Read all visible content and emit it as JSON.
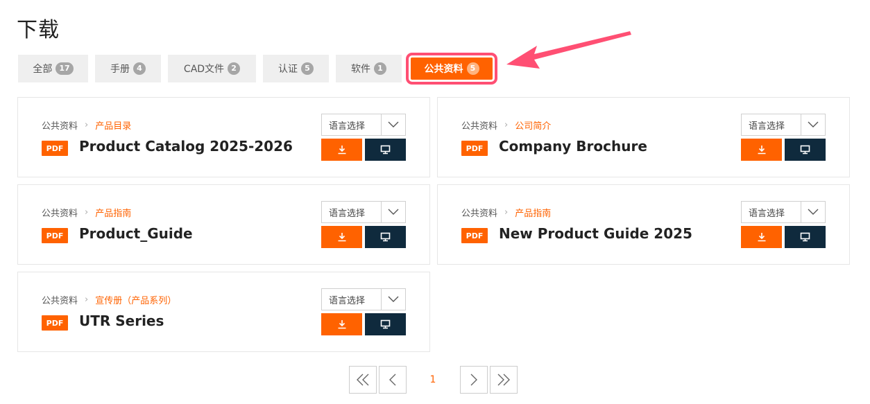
{
  "page": {
    "title": "下载"
  },
  "tabs": [
    {
      "label": "全部",
      "count": "17"
    },
    {
      "label": "手册",
      "count": "4"
    },
    {
      "label": "CAD文件",
      "count": "2"
    },
    {
      "label": "认证",
      "count": "5"
    },
    {
      "label": "软件",
      "count": "1"
    },
    {
      "label": "公共资料",
      "count": "5"
    }
  ],
  "cards": [
    {
      "crumb_root": "公共资料",
      "crumb_cat": "产品目录",
      "badge": "PDF",
      "title": "Product Catalog 2025-2026",
      "lang_label": "语言选择"
    },
    {
      "crumb_root": "公共资料",
      "crumb_cat": "公司简介",
      "badge": "PDF",
      "title": "Company Brochure",
      "lang_label": "语言选择"
    },
    {
      "crumb_root": "公共资料",
      "crumb_cat": "产品指南",
      "badge": "PDF",
      "title": "Product_Guide",
      "lang_label": "语言选择"
    },
    {
      "crumb_root": "公共资料",
      "crumb_cat": "产品指南",
      "badge": "PDF",
      "title": "New Product Guide 2025",
      "lang_label": "语言选择"
    },
    {
      "crumb_root": "公共资料",
      "crumb_cat": "宣传册（产品系列）",
      "badge": "PDF",
      "title": "UTR Series",
      "lang_label": "语言选择"
    }
  ],
  "pagination": {
    "current": "1"
  },
  "icons": {
    "download": "download-icon",
    "view": "monitor-icon",
    "select": "chevron-down-icon",
    "first": "double-chevron-left-icon",
    "prev": "chevron-left-icon",
    "next": "chevron-right-icon",
    "last": "double-chevron-right-icon"
  },
  "colors": {
    "accent": "#ff6200",
    "dark": "#0f2a3d",
    "highlight": "#ff4f73",
    "tab_bg": "#efefef"
  }
}
